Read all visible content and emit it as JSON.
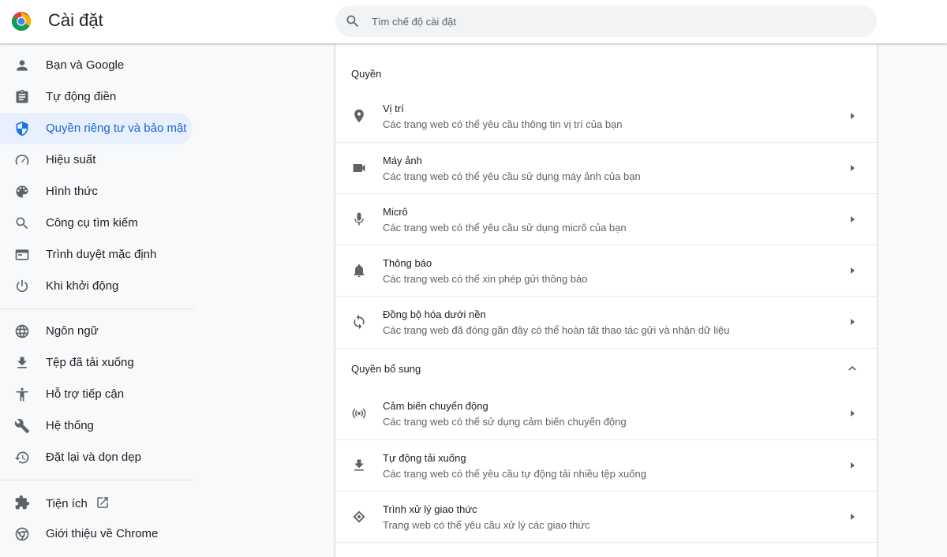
{
  "header": {
    "title": "Cài đặt",
    "search_placeholder": "Tìm chế độ cài đặt"
  },
  "colors": {
    "accent": "#1a73e8",
    "active_bg": "#e8f0fe",
    "active_text": "#1967d2",
    "icon_gray": "#5f6368",
    "text": "#202124"
  },
  "sidebar": {
    "items": [
      {
        "label": "Bạn và Google",
        "icon": "person-icon"
      },
      {
        "label": "Tự động điền",
        "icon": "clipboard-icon"
      },
      {
        "label": "Quyền riêng tư và bảo mật",
        "icon": "shield-icon",
        "active": true
      },
      {
        "label": "Hiệu suất",
        "icon": "speedometer-icon"
      },
      {
        "label": "Hình thức",
        "icon": "palette-icon"
      },
      {
        "label": "Công cụ tìm kiếm",
        "icon": "search-icon"
      },
      {
        "label": "Trình duyệt mặc định",
        "icon": "browser-window-icon"
      },
      {
        "label": "Khi khởi động",
        "icon": "power-icon"
      }
    ],
    "items2": [
      {
        "label": "Ngôn ngữ",
        "icon": "globe-icon"
      },
      {
        "label": "Tệp đã tải xuống",
        "icon": "download-icon"
      },
      {
        "label": "Hỗ trợ tiếp cận",
        "icon": "accessibility-icon"
      },
      {
        "label": "Hệ thống",
        "icon": "wrench-icon"
      },
      {
        "label": "Đặt lại và dọn dẹp",
        "icon": "reset-icon"
      }
    ],
    "items3": [
      {
        "label": "Tiện ích",
        "icon": "puzzle-icon"
      },
      {
        "label": "Giới thiệu về Chrome",
        "icon": "chrome-icon"
      }
    ]
  },
  "main": {
    "permissions_title": "Quyền",
    "permissions": [
      {
        "title": "Vị trí",
        "subtitle": "Các trang web có thể yêu cầu thông tin vị trí của bạn",
        "icon": "location-pin-icon"
      },
      {
        "title": "Máy ảnh",
        "subtitle": "Các trang web có thể yêu cầu sử dụng máy ảnh của bạn",
        "icon": "camera-icon"
      },
      {
        "title": "Micrô",
        "subtitle": "Các trang web có thể yêu cầu sử dụng micrô của bạn",
        "icon": "microphone-icon"
      },
      {
        "title": "Thông báo",
        "subtitle": "Các trang web có thể xin phép gửi thông báo",
        "icon": "bell-icon"
      },
      {
        "title": "Đồng bộ hóa dưới nền",
        "subtitle": "Các trang web đã đóng gần đây có thể hoàn tất thao tác gửi và nhận dữ liệu",
        "icon": "sync-icon"
      }
    ],
    "additional_title": "Quyền bổ sung",
    "additional": [
      {
        "title": "Cảm biến chuyển động",
        "subtitle": "Các trang web có thể sử dụng cảm biến chuyển động",
        "icon": "motion-sensor-icon"
      },
      {
        "title": "Tự động tải xuống",
        "subtitle": "Các trang web có thể yêu cầu tự động tải nhiều tệp xuống",
        "icon": "download-icon"
      },
      {
        "title": "Trình xử lý giao thức",
        "subtitle": "Trang web có thể yêu cầu xử lý các giao thức",
        "icon": "protocol-handler-icon"
      }
    ]
  }
}
